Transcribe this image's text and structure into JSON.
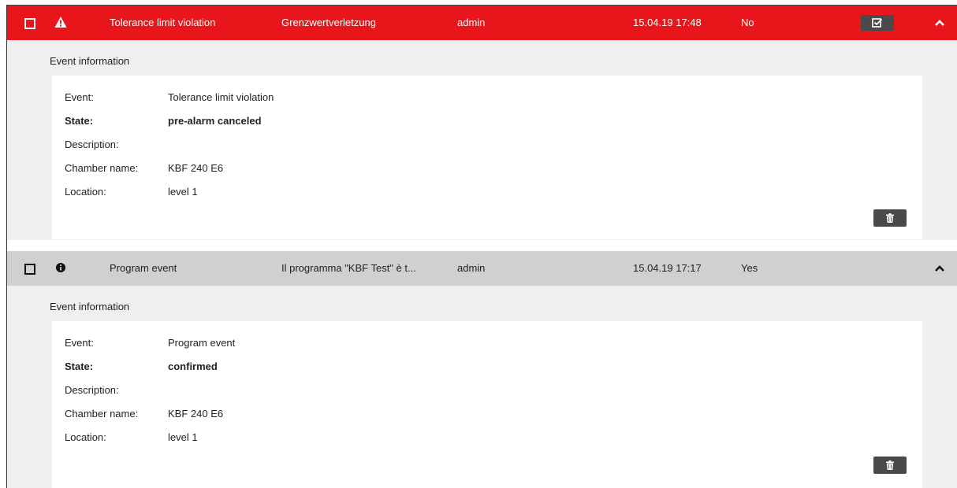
{
  "events": [
    {
      "header": {
        "name": "Tolerance limit violation",
        "message": "Grenzwertverletzung",
        "user": "admin",
        "time": "15.04.19 17:48",
        "acknowledged": "No"
      },
      "section_title": "Event information",
      "details": {
        "event_label": "Event:",
        "event_value": "Tolerance limit violation",
        "state_label": "State:",
        "state_value": "pre-alarm canceled",
        "description_label": "Description:",
        "description_value": "",
        "chamber_label": "Chamber name:",
        "chamber_value": "KBF 240 E6",
        "location_label": "Location:",
        "location_value": "level 1"
      },
      "severity_icon": "warning-triangle-icon",
      "header_color": "#e8161a"
    },
    {
      "header": {
        "name": "Program event",
        "message": "Il programma \"KBF Test\" è t...",
        "user": "admin",
        "time": "15.04.19 17:17",
        "acknowledged": "Yes"
      },
      "section_title": "Event information",
      "details": {
        "event_label": "Event:",
        "event_value": "Program event",
        "state_label": "State:",
        "state_value": "confirmed",
        "description_label": "Description:",
        "description_value": "",
        "chamber_label": "Chamber name:",
        "chamber_value": "KBF 240 E6",
        "location_label": "Location:",
        "location_value": "level 1"
      },
      "severity_icon": "info-circle-icon",
      "header_color": "#d0d0d0"
    }
  ]
}
